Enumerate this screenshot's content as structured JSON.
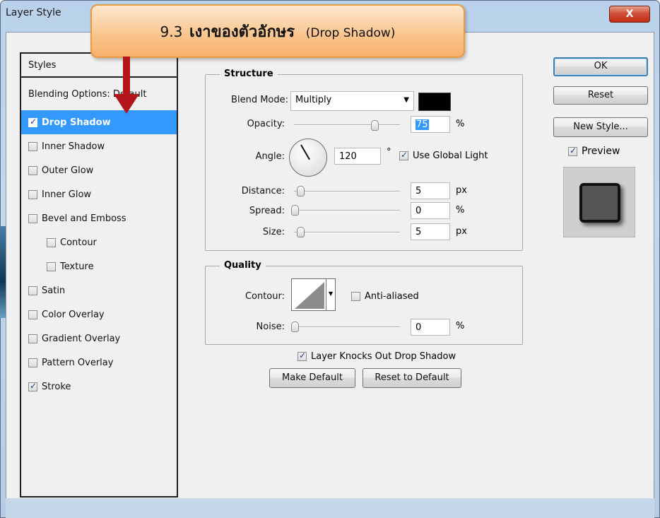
{
  "window": {
    "title": "Layer Style",
    "close_glyph": "X"
  },
  "callout": {
    "number": "9.3",
    "thai": "เงาของตัวอักษร",
    "english": "(Drop Shadow)"
  },
  "styles": {
    "header": "Styles",
    "blending": "Blending Options: Default",
    "items": [
      {
        "label": "Drop Shadow",
        "checked": true,
        "active": true
      },
      {
        "label": "Inner Shadow",
        "checked": false
      },
      {
        "label": "Outer Glow",
        "checked": false
      },
      {
        "label": "Inner Glow",
        "checked": false
      },
      {
        "label": "Bevel and Emboss",
        "checked": false
      },
      {
        "label": "Contour",
        "checked": false
      },
      {
        "label": "Texture",
        "checked": false
      },
      {
        "label": "Satin",
        "checked": false
      },
      {
        "label": "Color Overlay",
        "checked": false
      },
      {
        "label": "Gradient Overlay",
        "checked": false
      },
      {
        "label": "Pattern Overlay",
        "checked": false
      },
      {
        "label": "Stroke",
        "checked": true
      }
    ]
  },
  "structure": {
    "title": "Structure",
    "blend_mode_label": "Blend Mode:",
    "blend_mode_value": "Multiply",
    "blend_color": "#000000",
    "opacity_label": "Opacity:",
    "opacity_value": "75",
    "opacity_unit": "%",
    "angle_label": "Angle:",
    "angle_value": "120",
    "angle_unit": "°",
    "global_light_label": "Use Global Light",
    "global_light_checked": true,
    "distance_label": "Distance:",
    "distance_value": "5",
    "distance_unit": "px",
    "spread_label": "Spread:",
    "spread_value": "0",
    "spread_unit": "%",
    "size_label": "Size:",
    "size_value": "5",
    "size_unit": "px"
  },
  "quality": {
    "title": "Quality",
    "contour_label": "Contour:",
    "anti_aliased_label": "Anti-aliased",
    "anti_aliased_checked": false,
    "noise_label": "Noise:",
    "noise_value": "0",
    "noise_unit": "%"
  },
  "knockout": {
    "label": "Layer Knocks Out Drop Shadow",
    "checked": true
  },
  "buttons": {
    "make_default": "Make Default",
    "reset_default": "Reset to Default",
    "ok": "OK",
    "reset": "Reset",
    "new_style": "New Style...",
    "preview": "Preview",
    "preview_checked": true
  },
  "colors": {
    "selection": "#3399ff",
    "callout_border": "#e79a44",
    "arrow": "#b3141a"
  }
}
